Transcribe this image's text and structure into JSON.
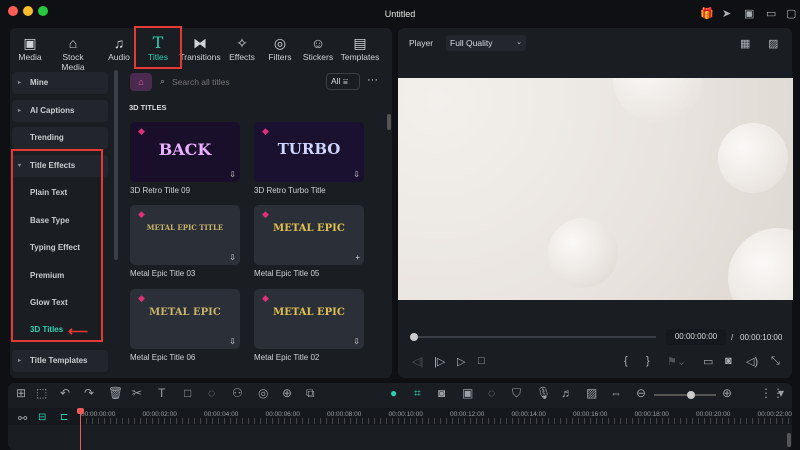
{
  "window": {
    "title": "Untitled"
  },
  "tabs": [
    {
      "label": "Media",
      "icon": "media-icon"
    },
    {
      "label": "Stock Media",
      "icon": "stock-media-icon"
    },
    {
      "label": "Audio",
      "icon": "music-icon"
    },
    {
      "label": "Titles",
      "icon": "titles-icon"
    },
    {
      "label": "Transitions",
      "icon": "transitions-icon"
    },
    {
      "label": "Effects",
      "icon": "effects-icon"
    },
    {
      "label": "Filters",
      "icon": "filters-icon"
    },
    {
      "label": "Stickers",
      "icon": "stickers-icon"
    },
    {
      "label": "Templates",
      "icon": "templates-icon"
    }
  ],
  "search": {
    "placeholder": "Search all titles",
    "filter": "All"
  },
  "sidebar": [
    "Mine",
    "AI Captions",
    "Trending",
    "Title Effects",
    "Plain Text",
    "Base Type",
    "Typing Effect",
    "Premium",
    "Glow Text",
    "3D Titles",
    "Title Templates"
  ],
  "section": "3D TITLES",
  "cards": [
    {
      "name": "3D Retro Title 09",
      "art": "BACK"
    },
    {
      "name": "3D Retro Turbo Title",
      "art": "TURBO"
    },
    {
      "name": "Metal Epic Title 03",
      "art": "METAL EPIC TITLE"
    },
    {
      "name": "Metal Epic Title 05",
      "art": "METAL EPIC"
    },
    {
      "name": "Metal Epic Title 06",
      "art": "METAL EPIC"
    },
    {
      "name": "Metal Epic Title 02",
      "art": "METAL EPIC"
    }
  ],
  "player": {
    "label": "Player",
    "quality": "Full Quality",
    "current": "00:00:00:00",
    "sep": "/",
    "total": "00:00:10:00",
    "in": "{",
    "out": "}"
  },
  "ruler": [
    "00:00:00:00",
    "00:00:02:00",
    "00:00:04:00",
    "00:00:06:00",
    "00:00:08:00",
    "00:00:10:00",
    "00:00:12:00",
    "00:00:14:00",
    "00:00:16:00",
    "00:00:18:00",
    "00:00:20:00",
    "00:00:22:00"
  ],
  "zoom_level": 0.6,
  "colors": {
    "accent": "#2fd0b2",
    "highlight": "#e53935"
  }
}
